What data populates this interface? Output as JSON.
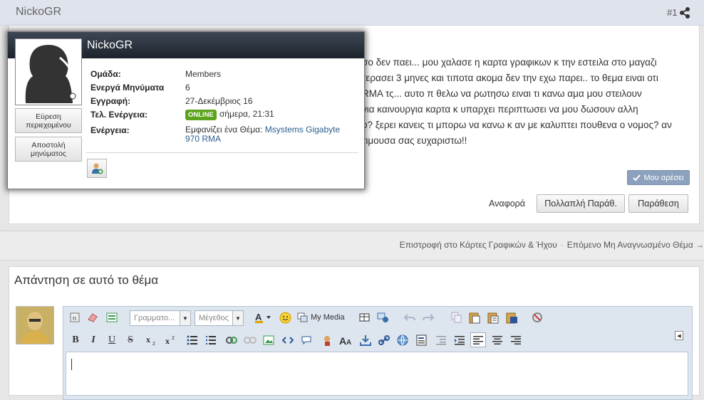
{
  "post": {
    "author": "NickoGR",
    "number": "#1",
    "lines": [
      "σο δεν παει... μου χαλασε η καρτα γραφικων κ την εστειλα στο μαγαζι",
      "τερασει 3 μηνες και τιποτα ακομα δεν την εχω παρει.. το θεμα ειναι οτι",
      "RMA τς... αυτο π θελω να ρωτησω ειναι τι κανω αμα μου στειλουν",
      "για καινουργια καρτα κ υπαρχει περιπτωσει να μου δωσουν αλλη",
      "o? ξερει κανεις τι μπορω να κανω κ αν με καλυπτει πουθενα ο νομος? αν",
      "τιμουσα σας ευχαριστω!!"
    ],
    "like_label": "Μου αρέσει",
    "report_label": "Αναφορά",
    "multiquote_label": "Πολλαπλή Παράθ.",
    "quote_label": "Παράθεση"
  },
  "nav": {
    "back_label": "Επιστροφή στο Κάρτες Γραφικών & Ήχου",
    "separator": "·",
    "next_label": "Επόμενο Μη Αναγνωσμένο Θέμα →"
  },
  "reply": {
    "title": "Απάντηση σε αυτό το θέμα",
    "font_placeholder": "Γραμματο...",
    "size_placeholder": "Μέγεθος",
    "my_media_label": "My Media",
    "bold": "B",
    "italic": "I",
    "underline": "U",
    "strike": "S"
  },
  "popup": {
    "name": "NickoGR",
    "find_content_label": "Εύρεση περιεχομένου",
    "send_message_label": "Αποστολή μηνύματος",
    "rows": [
      {
        "label": "Ομάδα:",
        "value": "Members"
      },
      {
        "label": "Ενεργά Μηνύματα",
        "value": "6"
      },
      {
        "label": "Εγγραφή:",
        "value": "27-Δεκέμβριος 16"
      }
    ],
    "activity_label": "Τελ. Ενέργεια:",
    "online_badge": "ONLINE",
    "activity_value": "σήμερα, 21:31",
    "action_label": "Ενέργεια:",
    "action_prefix": "Εμφανίζει ένα Θέμα:",
    "action_link": "Msystems Gigabyte 970 RMA"
  },
  "colors": {
    "header_dark": "#1c232c",
    "online_green": "#5da41e",
    "like_blue": "#8ca1bd",
    "link_blue": "#2a5d8f"
  }
}
